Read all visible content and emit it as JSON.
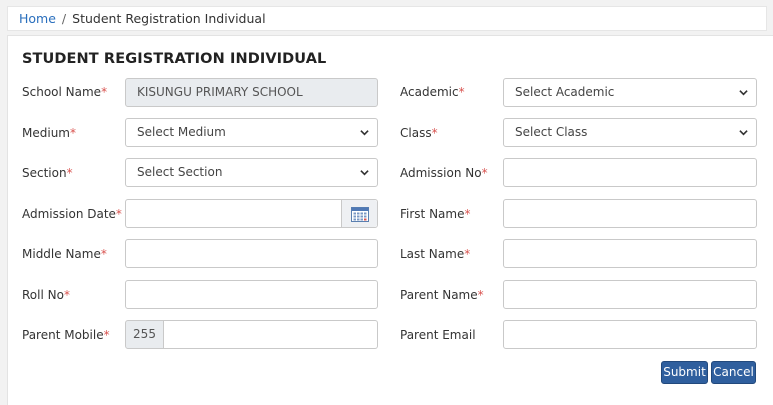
{
  "breadcrumb": {
    "home": "Home",
    "separator": "/",
    "current": "Student Registration Individual"
  },
  "title": "STUDENT REGISTRATION INDIVIDUAL",
  "form": {
    "school_name": {
      "label": "School Name",
      "value": "KISUNGU PRIMARY SCHOOL"
    },
    "academic": {
      "label": "Academic",
      "value": "Select Academic"
    },
    "medium": {
      "label": "Medium",
      "value": "Select Medium"
    },
    "class": {
      "label": "Class",
      "value": "Select Class"
    },
    "section": {
      "label": "Section",
      "value": "Select Section"
    },
    "admission_no": {
      "label": "Admission No",
      "value": ""
    },
    "admission_date": {
      "label": "Admission Date",
      "value": ""
    },
    "first_name": {
      "label": "First Name",
      "value": ""
    },
    "middle_name": {
      "label": "Middle Name",
      "value": ""
    },
    "last_name": {
      "label": "Last Name",
      "value": ""
    },
    "roll_no": {
      "label": "Roll No",
      "value": ""
    },
    "parent_name": {
      "label": "Parent Name",
      "value": ""
    },
    "parent_mobile": {
      "label": "Parent Mobile",
      "prefix": "255",
      "value": ""
    },
    "parent_email": {
      "label": "Parent Email",
      "value": ""
    },
    "required_marker": "*"
  },
  "buttons": {
    "submit": "Submit",
    "cancel": "Cancel"
  },
  "colors": {
    "link": "#2a6fbd",
    "required": "#d9534f",
    "button": "#2f5f9e"
  },
  "icons": {
    "select_arrow": "chevron-down-icon",
    "date_picker": "calendar-icon"
  }
}
